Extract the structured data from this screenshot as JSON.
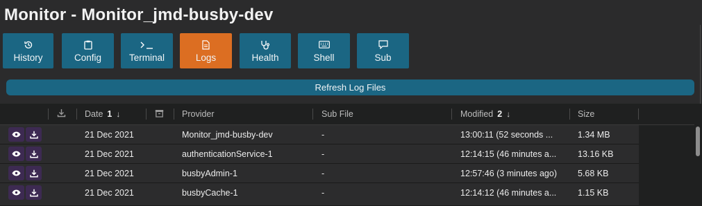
{
  "window": {
    "title": "Monitor - Monitor_jmd-busby-dev"
  },
  "toolbar": {
    "buttons": [
      {
        "label": "History",
        "icon": "history-icon"
      },
      {
        "label": "Config",
        "icon": "clipboard-icon"
      },
      {
        "label": "Terminal",
        "icon": "terminal-icon"
      },
      {
        "label": "Logs",
        "icon": "file-icon",
        "active": true
      },
      {
        "label": "Health",
        "icon": "stethoscope-icon"
      },
      {
        "label": "Shell",
        "icon": "keyboard-icon"
      },
      {
        "label": "Sub",
        "icon": "message-icon"
      }
    ],
    "refresh_label": "Refresh Log Files"
  },
  "table": {
    "columns": {
      "download": "download-icon",
      "date": "Date",
      "date_sort_order": "1",
      "archive": "archive-icon",
      "provider": "Provider",
      "subfile": "Sub File",
      "modified": "Modified",
      "modified_sort_order": "2",
      "size": "Size"
    },
    "rows": [
      {
        "date": "21 Dec 2021",
        "provider": "Monitor_jmd-busby-dev",
        "subfile": "-",
        "modified": "13:00:11 (52 seconds ...",
        "size": "1.34 MB"
      },
      {
        "date": "21 Dec 2021",
        "provider": "authenticationService-1",
        "subfile": "-",
        "modified": "12:14:15 (46 minutes a...",
        "size": "13.16 KB"
      },
      {
        "date": "21 Dec 2021",
        "provider": "busbyAdmin-1",
        "subfile": "-",
        "modified": "12:57:46 (3 minutes ago)",
        "size": "5.68 KB"
      },
      {
        "date": "21 Dec 2021",
        "provider": "busbyCache-1",
        "subfile": "-",
        "modified": "12:14:12 (46 minutes a...",
        "size": "1.15 KB"
      }
    ]
  },
  "colors": {
    "toolbar_button": "#1b6683",
    "active_button": "#dc6e22",
    "row_action_button": "#3d2a52"
  }
}
